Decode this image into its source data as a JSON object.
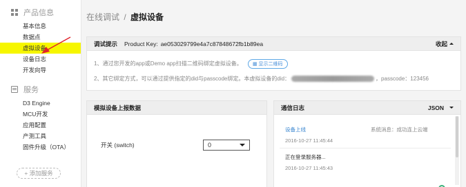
{
  "sidebar": {
    "product_section": "产品信息",
    "product_items": [
      "基本信息",
      "数据点",
      "虚拟设备",
      "设备日志",
      "开发向导"
    ],
    "service_section": "服务",
    "service_items": [
      "D3 Engine",
      "MCU开发",
      "应用配置",
      "产测工具",
      "固件升级（OTA）"
    ],
    "add_service": "+ 添加服务",
    "active_item": "虚拟设备"
  },
  "breadcrumb": {
    "parent": "在线调试",
    "separator": "/",
    "current": "虚拟设备"
  },
  "tip_panel": {
    "title": "调试提示",
    "product_key_label": "Product Key:",
    "product_key": "ae053029799e4a7c87848672fb1b89ea",
    "collapse_label": "收起",
    "line1": "1、通过您开发的app或Demo app扫描二维码绑定虚拟设备。",
    "qr_button": "显示二维码",
    "line2_prefix": "2、其它绑定方式，可以通过提供指定的did与passcode绑定。本虚拟设备的did：",
    "line2_suffix": "，passcode：123456"
  },
  "report_panel": {
    "title": "模拟设备上报数据",
    "field_label": "开关 (switch)",
    "field_value": "0"
  },
  "log_panel": {
    "title": "通信日志",
    "format": "JSON",
    "entries": [
      {
        "title": "设备上线",
        "time": "2016-10-27 11:45:44",
        "system": "系统消息：成功连上云端"
      },
      {
        "title": "正在登录服务器...",
        "time": "2016-10-27 11:45:43"
      }
    ]
  },
  "colors": {
    "highlight": "#f6f600",
    "accent": "#3a86d0",
    "arrow": "#e0242b"
  }
}
